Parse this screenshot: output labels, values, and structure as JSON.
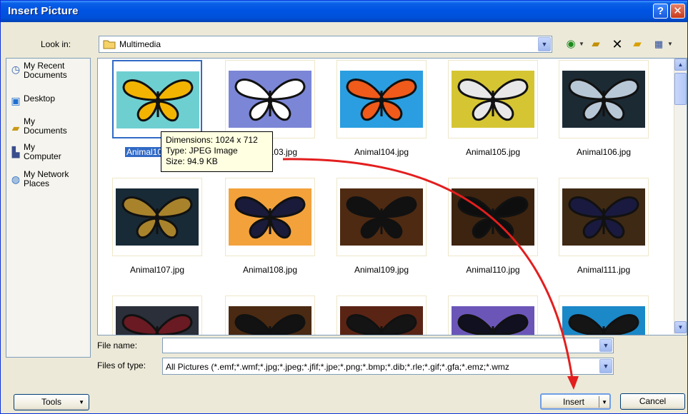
{
  "window": {
    "title": "Insert Picture",
    "help_glyph": "?",
    "close_glyph": "✕"
  },
  "lookin": {
    "label": "Look in:",
    "value": "Multimedia"
  },
  "places": [
    {
      "label_line1": "My Recent",
      "label_line2": "Documents",
      "icon": "recent-documents-icon"
    },
    {
      "label_line1": "Desktop",
      "label_line2": "",
      "icon": "desktop-icon"
    },
    {
      "label_line1": "My",
      "label_line2": "Documents",
      "icon": "my-documents-icon"
    },
    {
      "label_line1": "My",
      "label_line2": "Computer",
      "icon": "my-computer-icon"
    },
    {
      "label_line1": "My Network",
      "label_line2": "Places",
      "icon": "network-places-icon"
    }
  ],
  "files": [
    {
      "name": "Animal102.jpg",
      "bg": "#6ecfd1",
      "wing": "#f2b400",
      "selected": true
    },
    {
      "name": "Animal103.jpg",
      "bg": "#7b86d6",
      "wing": "#ffffff",
      "selected": false
    },
    {
      "name": "Animal104.jpg",
      "bg": "#2a9ee0",
      "wing": "#f05a1a",
      "selected": false
    },
    {
      "name": "Animal105.jpg",
      "bg": "#d5c533",
      "wing": "#e8e8e8",
      "selected": false
    },
    {
      "name": "Animal106.jpg",
      "bg": "#1c2a34",
      "wing": "#b8c7d6",
      "selected": false
    },
    {
      "name": "Animal107.jpg",
      "bg": "#182a36",
      "wing": "#a8832c",
      "selected": false
    },
    {
      "name": "Animal108.jpg",
      "bg": "#f3a23b",
      "wing": "#1a1a3a",
      "selected": false
    },
    {
      "name": "Animal109.jpg",
      "bg": "#4e2a12",
      "wing": "#111111",
      "selected": false
    },
    {
      "name": "Animal110.jpg",
      "bg": "#3d2410",
      "wing": "#0e0e0e",
      "selected": false
    },
    {
      "name": "Animal111.jpg",
      "bg": "#3e2914",
      "wing": "#1a1a40",
      "selected": false
    },
    {
      "name": "",
      "bg": "#2a2f3a",
      "wing": "#6a1a22",
      "selected": false
    },
    {
      "name": "",
      "bg": "#4a2a12",
      "wing": "#121212",
      "selected": false
    },
    {
      "name": "",
      "bg": "#5a2414",
      "wing": "#141414",
      "selected": false
    },
    {
      "name": "",
      "bg": "#6b56b8",
      "wing": "#101020",
      "selected": false
    },
    {
      "name": "",
      "bg": "#1b88c8",
      "wing": "#151515",
      "selected": false
    }
  ],
  "selected_caption": "Animal10",
  "tooltip": {
    "line1": "Dimensions: 1024 x 712",
    "line2": "Type: JPEG Image",
    "line3": "Size: 94.9 KB"
  },
  "fields": {
    "file_name_label": "File name:",
    "file_name_value": "",
    "files_of_type_label": "Files of type:",
    "files_of_type_value": "All Pictures (*.emf;*.wmf;*.jpg;*.jpeg;*.jfif;*.jpe;*.png;*.bmp;*.dib;*.rle;*.gif;*.gfa;*.emz;*.wmz"
  },
  "buttons": {
    "tools": "Tools",
    "insert": "Insert",
    "cancel": "Cancel"
  },
  "colors": {
    "titlebar": "#0054e3",
    "selection": "#316ac5",
    "annotation_arrow": "#e31e1e"
  }
}
